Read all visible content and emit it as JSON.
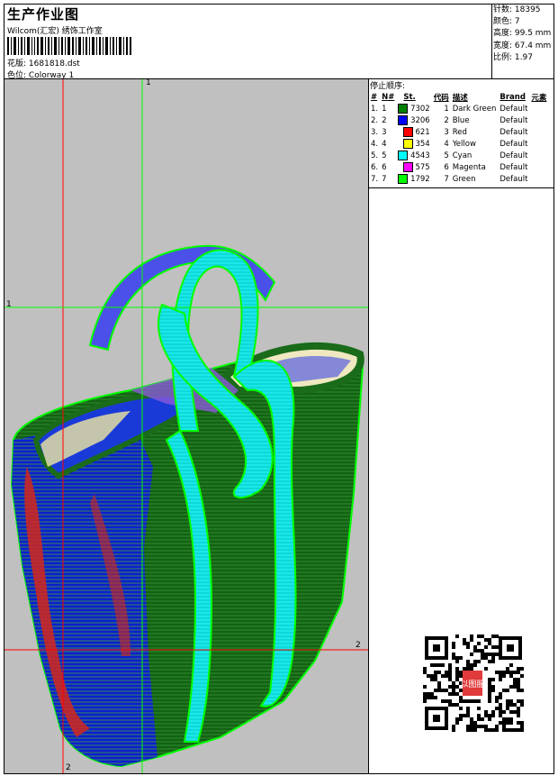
{
  "header": {
    "title": "生产作业图",
    "company": "Wilcom(汇宏) 绣饰工作室",
    "design_label": "花版:",
    "design_file": "1681818.dst",
    "colorway_label": "色位:",
    "colorway_value": "Colorway 1"
  },
  "stats": {
    "stitches": "针数: 18395",
    "colors": "颜色: 7",
    "height": "高度: 99.5 mm",
    "width": "宽度: 67.4 mm",
    "scale": "比例: 1.97"
  },
  "stop_sequence": {
    "title": "停止顺序:",
    "headers": [
      "#",
      "N#",
      "St.",
      "代码",
      "描述",
      "Brand",
      "元素"
    ],
    "rows": [
      {
        "idx": "1.",
        "n": "1",
        "color": "#008000",
        "st": "7302",
        "code": "1",
        "desc": "Dark Green",
        "brand": "Default"
      },
      {
        "idx": "2.",
        "n": "2",
        "color": "#0000ff",
        "st": "3206",
        "code": "2",
        "desc": "Blue",
        "brand": "Default"
      },
      {
        "idx": "3.",
        "n": "3",
        "color": "#ff0000",
        "st": "621",
        "code": "3",
        "desc": "Red",
        "brand": "Default"
      },
      {
        "idx": "4.",
        "n": "4",
        "color": "#ffff00",
        "st": "354",
        "code": "4",
        "desc": "Yellow",
        "brand": "Default"
      },
      {
        "idx": "5.",
        "n": "5",
        "color": "#00ffff",
        "st": "4543",
        "code": "5",
        "desc": "Cyan",
        "brand": "Default"
      },
      {
        "idx": "6.",
        "n": "6",
        "color": "#ff00ff",
        "st": "575",
        "code": "6",
        "desc": "Magenta",
        "brand": "Default"
      },
      {
        "idx": "7.",
        "n": "7",
        "color": "#00ff00",
        "st": "1792",
        "code": "7",
        "desc": "Green",
        "brand": "Default"
      }
    ]
  },
  "guides": {
    "v1": "1",
    "h1": "1",
    "h2": "2",
    "v2": "2"
  },
  "qr": {
    "stamp_text": "以图服"
  }
}
